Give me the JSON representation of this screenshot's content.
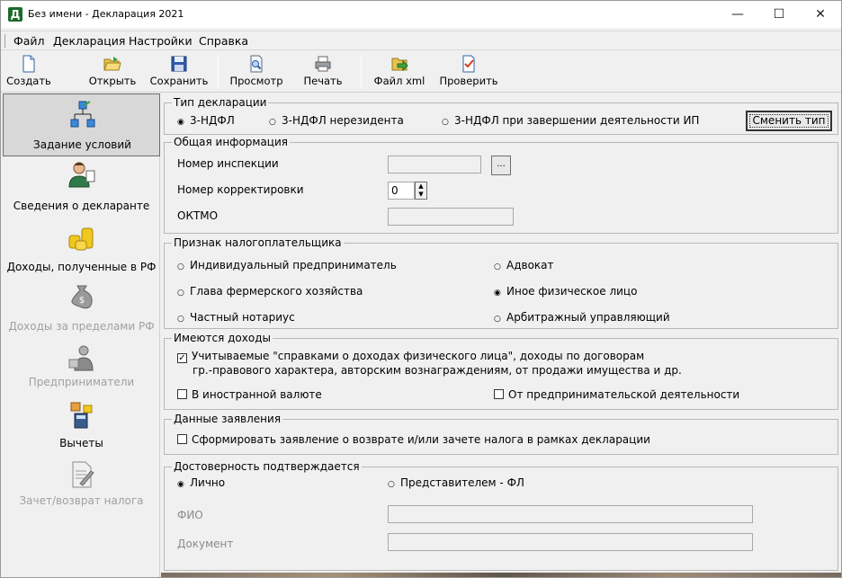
{
  "window": {
    "title": "Без имени - Декларация 2021",
    "app_icon": "Д",
    "minimize": "—",
    "maximize": "☐",
    "close": "✕"
  },
  "menu": [
    "Файл",
    "Декларация",
    "Настройки",
    "Справка"
  ],
  "toolbar": [
    {
      "label": "Создать",
      "icon": "new-document-icon"
    },
    {
      "label": "Открыть",
      "icon": "open-folder-icon"
    },
    {
      "label": "Сохранить",
      "icon": "save-disk-icon"
    },
    {
      "label": "Просмотр",
      "icon": "preview-icon"
    },
    {
      "label": "Печать",
      "icon": "printer-icon"
    },
    {
      "label": "Файл xml",
      "icon": "xml-file-icon"
    },
    {
      "label": "Проверить",
      "icon": "check-document-icon"
    }
  ],
  "sidebar": [
    {
      "label": "Задание условий",
      "icon": "conditions-diagram-icon",
      "selected": true,
      "enabled": true
    },
    {
      "label": "Сведения о декларанте",
      "icon": "person-icon",
      "selected": false,
      "enabled": true
    },
    {
      "label": "Доходы, полученные в РФ",
      "icon": "coins-icon",
      "selected": false,
      "enabled": true
    },
    {
      "label": "Доходы за пределами РФ",
      "icon": "money-bag-icon",
      "selected": false,
      "enabled": false
    },
    {
      "label": "Предприниматели",
      "icon": "entrepreneur-icon",
      "selected": false,
      "enabled": false
    },
    {
      "label": "Вычеты",
      "icon": "deductions-icon",
      "selected": false,
      "enabled": true
    },
    {
      "label": "Зачет/возврат налога",
      "icon": "tax-refund-icon",
      "selected": false,
      "enabled": false
    }
  ],
  "declaration_type": {
    "title": "Тип декларации",
    "options": [
      "3-НДФЛ",
      "3-НДФЛ нерезидента",
      "3-НДФЛ при завершении деятельности ИП"
    ],
    "selected": "3-НДФЛ",
    "change_button": "Сменить тип"
  },
  "general_info": {
    "title": "Общая информация",
    "inspection_label": "Номер инспекции",
    "inspection_value": "",
    "browse_button": "...",
    "correction_label": "Номер корректировки",
    "correction_value": "0",
    "oktmo_label": "ОКТМО",
    "oktmo_value": ""
  },
  "taxpayer": {
    "title": "Признак налогоплательщика",
    "options": [
      "Индивидуальный предприниматель",
      "Адвокат",
      "Глава фермерского хозяйства",
      "Иное физическое лицо",
      "Частный нотариус",
      "Арбитражный управляющий"
    ],
    "selected": "Иное физическое лицо"
  },
  "income": {
    "title": "Имеются доходы",
    "main_line1": "Учитываемые \"справками о доходах физического лица\", доходы по договорам",
    "main_line2": "гр.-правового характера, авторским вознаграждениям, от продажи имущества и др.",
    "main_checked": true,
    "foreign_currency": "В иностранной валюте",
    "foreign_checked": false,
    "business": "От предпринимательской деятельности",
    "business_checked": false
  },
  "application": {
    "title": "Данные заявления",
    "option": "Сформировать заявление о  возврате и/или зачете налога в рамках декларации",
    "checked": false
  },
  "confirmation": {
    "title": "Достоверность подтверждается",
    "personal": "Лично",
    "representative": "Представителем - ФЛ",
    "selected": "Лично",
    "fio_label": "ФИО",
    "fio_value": "",
    "document_label": "Документ",
    "document_value": ""
  }
}
